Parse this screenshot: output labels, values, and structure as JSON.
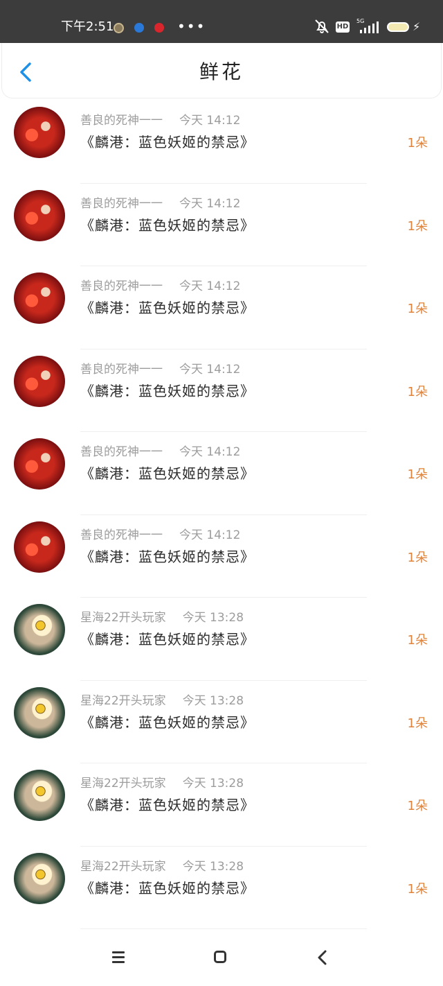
{
  "status_bar": {
    "time": "下午2:51",
    "more": "•••",
    "network": "5G",
    "hd": "HD",
    "icons": [
      "app-icon-1",
      "app-icon-2",
      "app-icon-3",
      "mute-icon",
      "hd-icon",
      "signal-icon",
      "battery-icon",
      "charging-icon"
    ]
  },
  "header": {
    "title": "鲜花",
    "back_icon": "chevron-left-icon",
    "accent_color": "#1e90e6"
  },
  "items": [
    {
      "user": "善良的死神一一",
      "time": "今天 14:12",
      "book": "《麟港：蓝色妖姬的禁忌》",
      "count": "1朵",
      "avatar": "red-character-avatar"
    },
    {
      "user": "善良的死神一一",
      "time": "今天 14:12",
      "book": "《麟港：蓝色妖姬的禁忌》",
      "count": "1朵",
      "avatar": "red-character-avatar"
    },
    {
      "user": "善良的死神一一",
      "time": "今天 14:12",
      "book": "《麟港：蓝色妖姬的禁忌》",
      "count": "1朵",
      "avatar": "red-character-avatar"
    },
    {
      "user": "善良的死神一一",
      "time": "今天 14:12",
      "book": "《麟港：蓝色妖姬的禁忌》",
      "count": "1朵",
      "avatar": "red-character-avatar"
    },
    {
      "user": "善良的死神一一",
      "time": "今天 14:12",
      "book": "《麟港：蓝色妖姬的禁忌》",
      "count": "1朵",
      "avatar": "red-character-avatar"
    },
    {
      "user": "善良的死神一一",
      "time": "今天 14:12",
      "book": "《麟港：蓝色妖姬的禁忌》",
      "count": "1朵",
      "avatar": "red-character-avatar"
    },
    {
      "user": "星海22开头玩家",
      "time": "今天 13:28",
      "book": "《麟港：蓝色妖姬的禁忌》",
      "count": "1朵",
      "avatar": "eye-avatar"
    },
    {
      "user": "星海22开头玩家",
      "time": "今天 13:28",
      "book": "《麟港：蓝色妖姬的禁忌》",
      "count": "1朵",
      "avatar": "eye-avatar"
    },
    {
      "user": "星海22开头玩家",
      "time": "今天 13:28",
      "book": "《麟港：蓝色妖姬的禁忌》",
      "count": "1朵",
      "avatar": "eye-avatar"
    },
    {
      "user": "星海22开头玩家",
      "time": "今天 13:28",
      "book": "《麟港：蓝色妖姬的禁忌》",
      "count": "1朵",
      "avatar": "eye-avatar"
    }
  ],
  "colors": {
    "count": "#e0833a",
    "meta": "#9c9c9c",
    "status_bar": "#3c3c3c"
  },
  "nav_bar": {
    "icons": [
      "menu-icon",
      "home-icon",
      "back-icon"
    ]
  }
}
